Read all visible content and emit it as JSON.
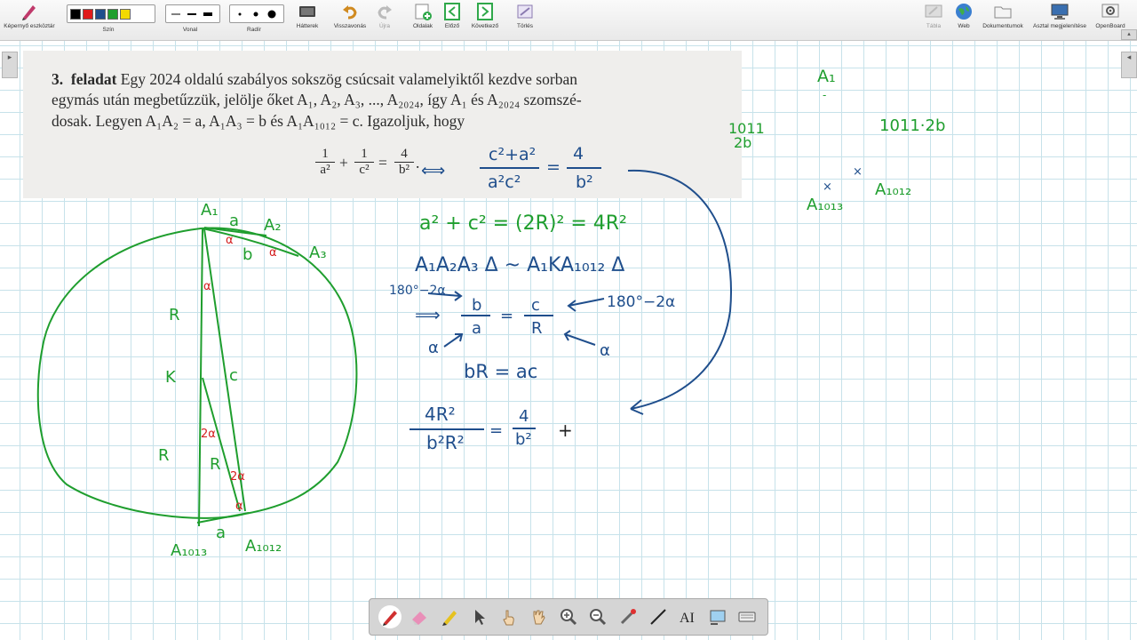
{
  "toolbar": {
    "left": [
      {
        "name": "toolbar-button",
        "label": "Képernyő eszköztár"
      },
      {
        "name": "background-button",
        "label": "Hátterek"
      },
      {
        "name": "undo-button",
        "label": "Visszavonás"
      },
      {
        "name": "redo-button",
        "label": "Újra"
      },
      {
        "name": "pages-button",
        "label": "Oldalak"
      },
      {
        "name": "previous-button",
        "label": "Előző"
      },
      {
        "name": "next-button",
        "label": "Következő"
      },
      {
        "name": "delete-button",
        "label": "Törlés"
      }
    ],
    "right": [
      {
        "name": "board-button",
        "label": "Tábla"
      },
      {
        "name": "web-button",
        "label": "Web"
      },
      {
        "name": "documents-button",
        "label": "Dokumentumok"
      },
      {
        "name": "desktop-button",
        "label": "Asztal megjelenítése"
      },
      {
        "name": "openboard-button",
        "label": "OpenBoard"
      }
    ],
    "color_label": "Szín",
    "line_label": "Vonal",
    "eraser_label": "Radír",
    "colors": [
      "#000000",
      "#e01b1b",
      "#1f4e8c",
      "#1f9e2e",
      "#f2d900"
    ]
  },
  "problem": {
    "number": "3.",
    "word": "feladat",
    "line1": " Egy 2024 oldalú szabályos sokszög csúcsait valamelyiktől kezdve sorban",
    "line2": "egymás után megbetűzzük, jelölje őket A₁, A₂, A₃, ..., A₂₀₂₄, így A₁ és A₂₀₂₄ szomszé-",
    "line3": "dosak. Legyen A₁A₂ = a, A₁A₃ = b és A₁A₁₀₁₂ = c. Igazoljuk, hogy",
    "f1_num": "1",
    "f1_den": "a²",
    "plus": "+",
    "f2_num": "1",
    "f2_den": "c²",
    "eq": "=",
    "f3_num": "4",
    "f3_den": "b²",
    "dot": "."
  },
  "handwriting": {
    "equiv": "⟺",
    "top_frac_num": "c²+a²",
    "top_frac_den": "a²c²",
    "top_eq": "=",
    "top_rhs_num": "4",
    "top_rhs_den": "b²",
    "eq1": "a² + c² = (2R)² = 4R²",
    "eq2": "A₁A₂A₃ Δ ~ A₁KA₁₀₁₂ Δ",
    "angle_left": "180°−2α",
    "angle_right": "180°−2α",
    "impl": "⟹",
    "ratio_lhs_num": "b",
    "ratio_lhs_den": "a",
    "ratio_eq": "=",
    "ratio_rhs_num": "c",
    "ratio_rhs_den": "R",
    "alpha_left": "α",
    "alpha_right": "α",
    "eq4": "bR = ac",
    "last_num": "4R²",
    "last_den": "b²R²",
    "last_eq": "=",
    "last_rhs_num": "4",
    "last_rhs_den": "b²",
    "plus_cursor": "+",
    "diag_A1": "A₁",
    "diag_A2": "A₂",
    "diag_A3": "A₃",
    "diag_a": "a",
    "diag_b": "b",
    "diag_c": "c",
    "diag_R1": "R",
    "diag_R2": "R",
    "diag_R3": "R",
    "diag_K": "K",
    "diag_A1013": "A₁₀₁₃",
    "diag_A1012": "A₁₀₁₂",
    "diag_a2": "a",
    "angle_marks": [
      "α",
      "α",
      "α",
      "2α",
      "2α",
      "α"
    ],
    "side_A1": "A₁",
    "side_1011": "1011",
    "side_2b": "2b",
    "side_1011_2b": "1011·2b",
    "side_A1013": "A₁₀₁₃",
    "side_A1012": "A₁₀₁₂"
  },
  "colors": {
    "green": "#1f9e2e",
    "blue": "#1f4e8c",
    "red": "#d42020"
  }
}
